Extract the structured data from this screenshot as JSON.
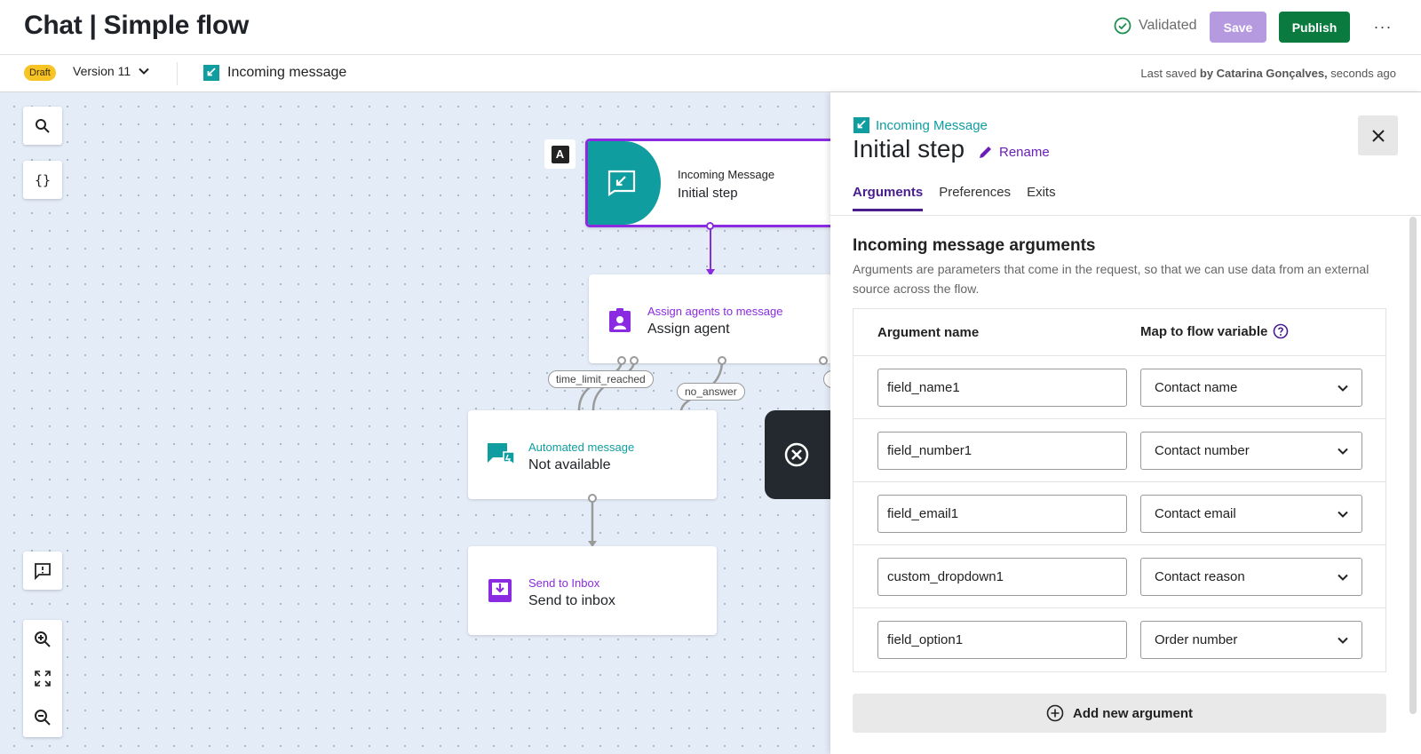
{
  "header": {
    "title": "Chat | Simple flow",
    "validated_label": "Validated",
    "save_label": "Save",
    "publish_label": "Publish",
    "more_label": "···"
  },
  "subbar": {
    "draft_badge": "Draft",
    "version_label": "Version 11",
    "step_label": "Incoming message",
    "last_saved_prefix": "Last saved ",
    "last_saved_by": "by Catarina Gonçalves,",
    "last_saved_suffix": " seconds ago"
  },
  "canvas": {
    "tools": [
      "search-icon",
      "braces-icon",
      "feedback-icon",
      "zoom-in-icon",
      "fit-screen-icon",
      "zoom-out-icon"
    ],
    "braces_label": "{}",
    "marker_label": "A",
    "nodes": [
      {
        "type": "Incoming Message",
        "name": "Initial step"
      },
      {
        "type": "Assign agents to message",
        "name": "Assign agent"
      },
      {
        "type": "Automated message",
        "name": "Not available"
      },
      {
        "type": "Send to Inbox",
        "name": "Send to inbox"
      }
    ],
    "edge_labels": [
      "time_limit_reached",
      "no_answer"
    ]
  },
  "panel": {
    "node_type": "Incoming Message",
    "title": "Initial step",
    "rename_label": "Rename",
    "tabs": [
      "Arguments",
      "Preferences",
      "Exits"
    ],
    "section_title": "Incoming message arguments",
    "section_desc": "Arguments are parameters that come in the request, so that we can use data from an external source across the flow.",
    "col_argument": "Argument name",
    "col_variable": "Map to flow variable",
    "rows": [
      {
        "arg": "field_name1",
        "var": "Contact name"
      },
      {
        "arg": "field_number1",
        "var": "Contact number"
      },
      {
        "arg": "field_email1",
        "var": "Contact email"
      },
      {
        "arg": "custom_dropdown1",
        "var": "Contact reason"
      },
      {
        "arg": "field_option1",
        "var": "Order number"
      }
    ],
    "add_label": "Add new argument"
  },
  "colors": {
    "purple": "#8a2be2",
    "teal": "#0f9da0",
    "publish_green": "#0a7a3f",
    "save_disabled": "#b69ae0",
    "draft_yellow": "#f7c325"
  }
}
